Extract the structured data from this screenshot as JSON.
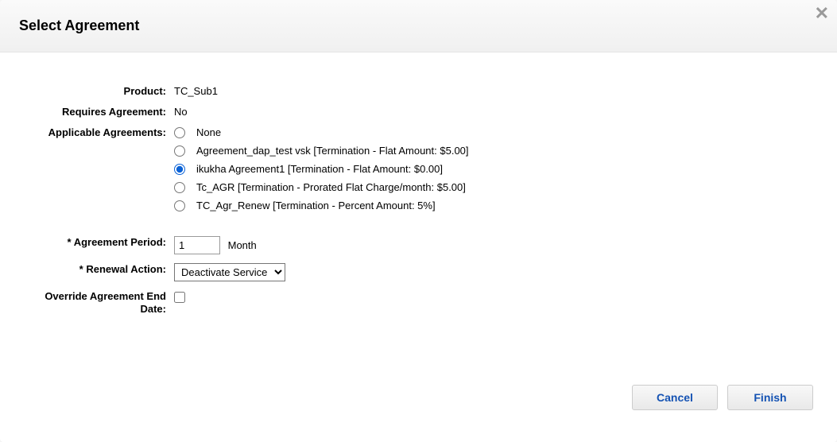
{
  "dialog": {
    "title": "Select Agreement",
    "close_icon": "✕"
  },
  "form": {
    "product": {
      "label": "Product:",
      "value": "TC_Sub1"
    },
    "requires_agreement": {
      "label": "Requires Agreement:",
      "value": "No"
    },
    "applicable_agreements": {
      "label": "Applicable Agreements:",
      "options": [
        {
          "label": "None",
          "selected": false
        },
        {
          "label": "Agreement_dap_test vsk [Termination - Flat Amount: $5.00]",
          "selected": false
        },
        {
          "label": "ikukha Agreement1 [Termination - Flat Amount: $0.00]",
          "selected": true
        },
        {
          "label": "Tc_AGR [Termination - Prorated Flat Charge/month: $5.00]",
          "selected": false
        },
        {
          "label": "TC_Agr_Renew [Termination - Percent Amount: 5%]",
          "selected": false
        }
      ]
    },
    "agreement_period": {
      "label": "* Agreement Period:",
      "value": "1",
      "unit": "Month"
    },
    "renewal_action": {
      "label": "* Renewal Action:",
      "value": "Deactivate Service",
      "options": [
        "Deactivate Service"
      ]
    },
    "override_end_date": {
      "label": "Override Agreement End Date:",
      "checked": false
    }
  },
  "buttons": {
    "cancel": "Cancel",
    "finish": "Finish"
  }
}
